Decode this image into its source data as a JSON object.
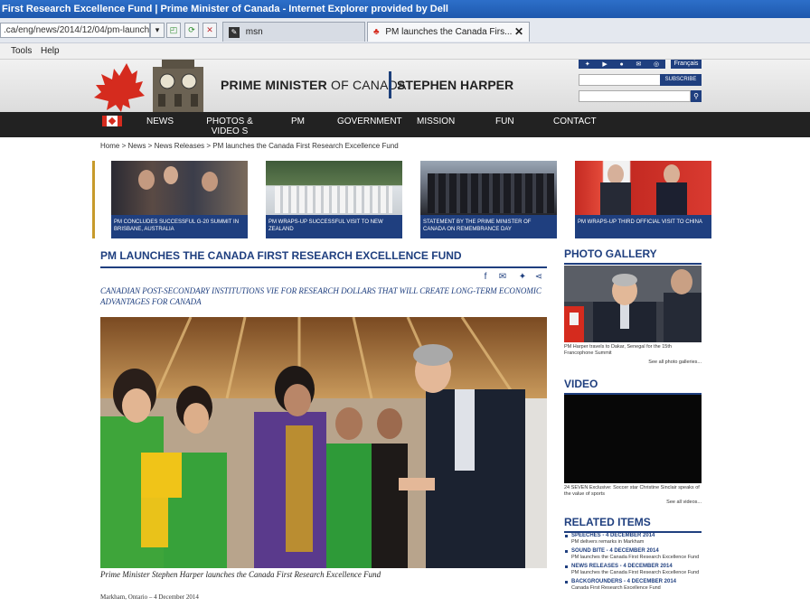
{
  "browser": {
    "title": "First Research Excellence Fund | Prime Minister of Canada - Internet Explorer provided by Dell",
    "address": ".ca/eng/news/2014/12/04/pm-launch",
    "tabs": [
      {
        "label": "msn"
      },
      {
        "label": "PM launches the Canada Firs..."
      }
    ],
    "menu": [
      "Tools",
      "Help"
    ]
  },
  "header": {
    "title_bold": "PRIME MINISTER",
    "title_rest": " OF CANADA",
    "name": "STEPHEN HARPER",
    "language_button": "Français",
    "subscribe_button": "SUBSCRIBE"
  },
  "nav": {
    "items": [
      "NEWS",
      "PHOTOS & VIDEO S",
      "PM",
      "GOVERNMENT",
      "MISSION",
      "FUN",
      "CONTACT"
    ]
  },
  "breadcrumb": "Home > News > News Releases > PM launches the Canada First Research Excellence Fund",
  "carousel": [
    {
      "caption": "PM CONCLUDES SUCCESSFUL G-20 SUMMIT IN BRISBANE, AUSTRALIA"
    },
    {
      "caption": "PM WRAPS-UP SUCCESSFUL VISIT TO NEW ZEALAND"
    },
    {
      "caption": "STATEMENT BY THE PRIME MINISTER OF CANADA ON REMEMBRANCE DAY"
    },
    {
      "caption": "PM WRAPS-UP THIRD OFFICIAL VISIT TO CHINA"
    }
  ],
  "article": {
    "title": "PM LAUNCHES THE CANADA FIRST RESEARCH EXCELLENCE FUND",
    "subtitle": "CANADIAN POST-SECONDARY INSTITUTIONS VIE FOR RESEARCH DOLLARS THAT WILL CREATE LONG-TERM ECONOMIC ADVANTAGES FOR CANADA",
    "photo_caption": "Prime Minister Stephen Harper launches the Canada First Research Excellence Fund",
    "dateline": "Markham, Ontario – 4 December 2014"
  },
  "sidebar": {
    "gallery": {
      "heading": "PHOTO GALLERY",
      "caption": "PM Harper travels to Dakar, Senegal for the 15th Francophone Summit",
      "more": "See all photo galleries..."
    },
    "video": {
      "heading": "VIDEO",
      "caption": "24 SEVEN Exclusive: Soccer star Christine Sinclair speaks of the value of sports",
      "more": "See all videos..."
    },
    "related": {
      "heading": "RELATED ITEMS",
      "items": [
        {
          "category": "SPEECHES - 4 DECEMBER 2014",
          "desc": "PM delivers remarks in Markham"
        },
        {
          "category": "SOUND BITE - 4 DECEMBER 2014",
          "desc": "PM launches the Canada First Research Excellence Fund"
        },
        {
          "category": "NEWS RELEASES - 4 DECEMBER 2014",
          "desc": "PM launches the Canada First Research Excellence Fund"
        },
        {
          "category": "BACKGROUNDERS - 4 DECEMBER 2014",
          "desc": "Canada First Research Excellence Fund"
        }
      ]
    }
  },
  "colors": {
    "brand_blue": "#1f3f7f",
    "nav_bg": "#222222",
    "canada_red": "#d52b1e"
  }
}
